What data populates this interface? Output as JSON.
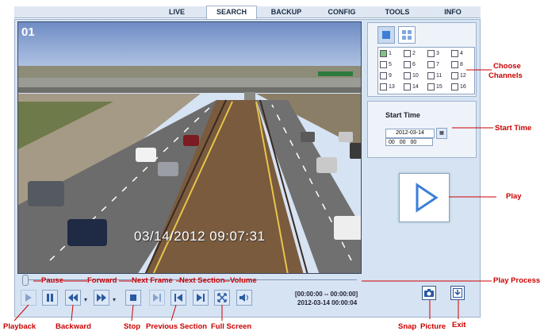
{
  "tabs": [
    "LIVE",
    "SEARCH",
    "BACKUP",
    "CONFIG",
    "TOOLS",
    "INFO"
  ],
  "active_tab": "SEARCH",
  "video": {
    "channel_label": "01",
    "timestamp": "03/14/2012 09:07:31"
  },
  "channels": {
    "items": [
      "1",
      "2",
      "3",
      "4",
      "5",
      "6",
      "7",
      "8",
      "9",
      "10",
      "11",
      "12",
      "13",
      "14",
      "15",
      "16"
    ],
    "checked": [
      "1"
    ]
  },
  "start_time": {
    "title": "Start Time",
    "date": "2012-03-14",
    "hour": "00",
    "minute": "00",
    "second": "00"
  },
  "playback": {
    "time_range": "[00:00:00 -- 00:00:00]",
    "current_time": "2012-03-14 00:00:04"
  },
  "annotations": {
    "pause": "Pause",
    "forward": "Forward",
    "next_frame": "Next Frame",
    "next_section": "Next Section",
    "volume": "Volume",
    "playback": "Playback",
    "backward": "Backward",
    "stop": "Stop",
    "previous_section": "Previous Section",
    "full_screen": "Full Screen",
    "snap": "Snap",
    "picture": "Picture",
    "exit": "Exit",
    "choose": "Choose",
    "channels": "Channels",
    "start_time": "Start Time",
    "play": "Play",
    "play_process": "Play Process"
  },
  "colors": {
    "annotation": "#cc0000",
    "panel": "#d6e3f3",
    "button": "#3a5a8a"
  },
  "icons": [
    "play-icon",
    "pause-icon",
    "backward-icon",
    "forward-icon",
    "stop-icon",
    "next-frame-icon",
    "previous-section-icon",
    "next-section-icon",
    "full-screen-icon",
    "volume-icon",
    "camera-icon",
    "exit-icon",
    "single-view-icon",
    "quad-view-icon",
    "calendar-icon"
  ]
}
